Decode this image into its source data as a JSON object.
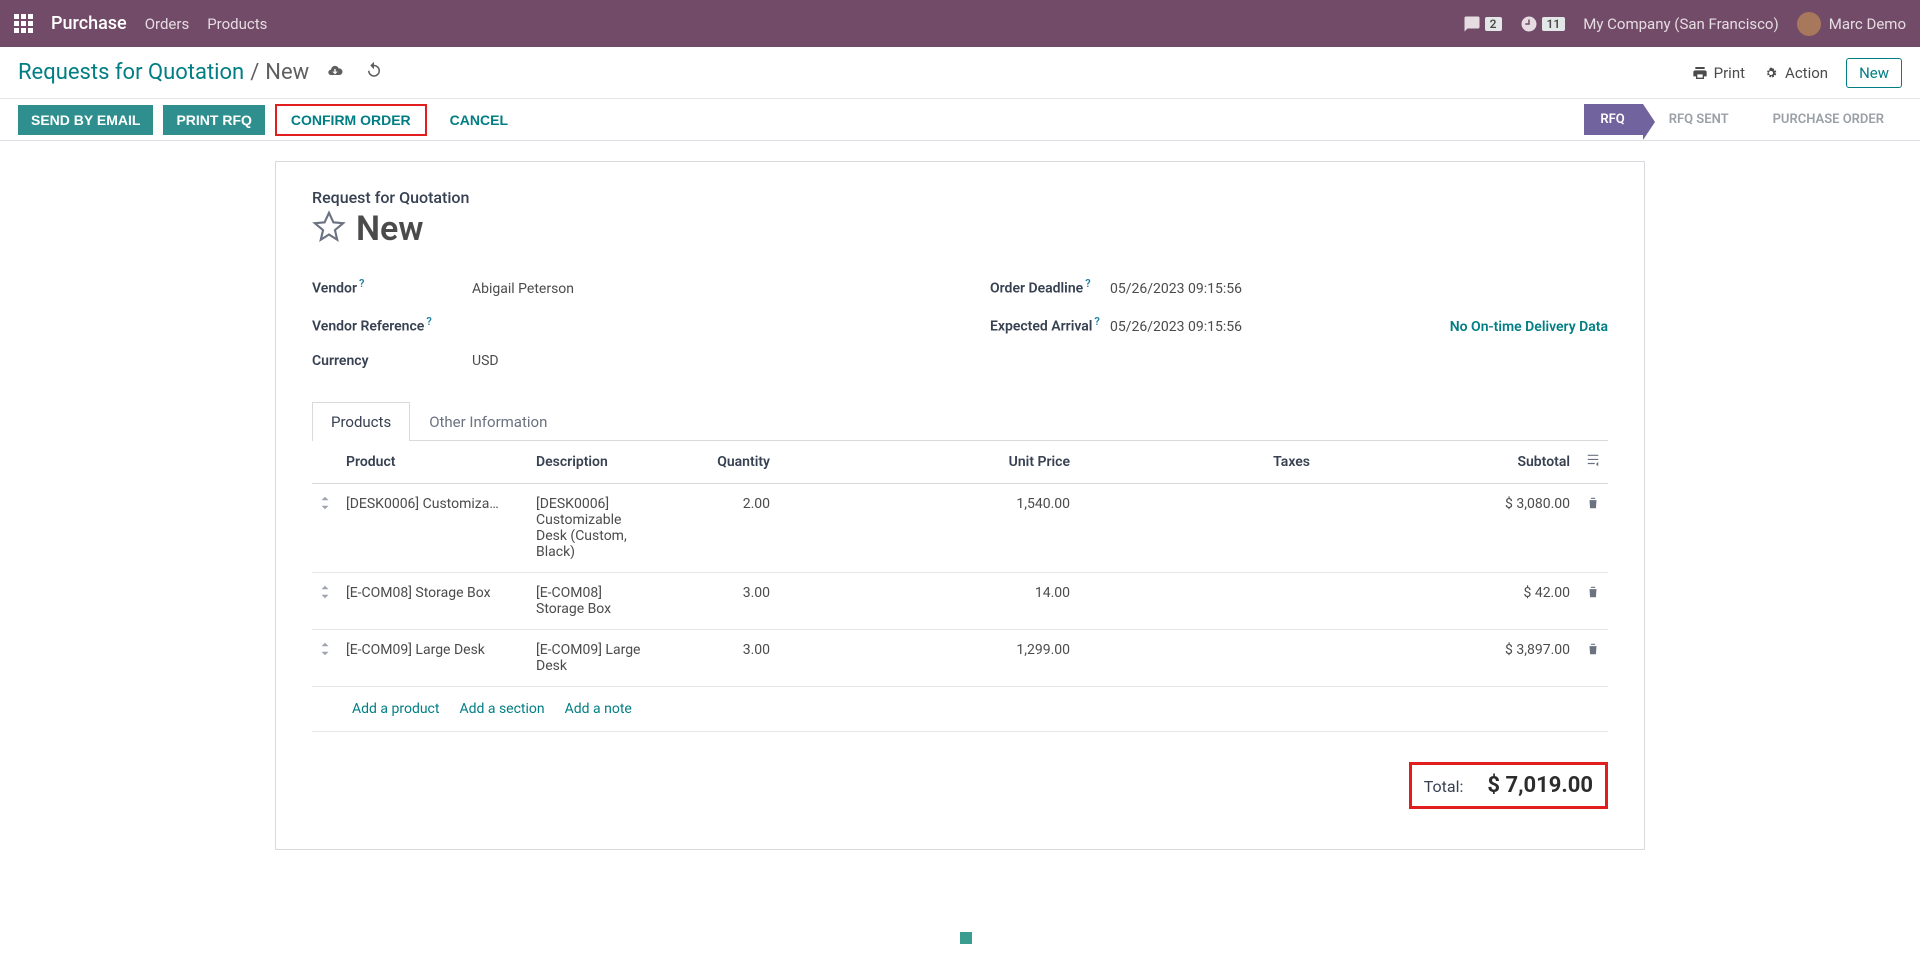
{
  "topnav": {
    "brand": "Purchase",
    "menu": [
      "Orders",
      "Products"
    ],
    "chat_count": "2",
    "clock_count": "11",
    "company": "My Company (San Francisco)",
    "user": "Marc Demo"
  },
  "breadcrumb": {
    "root": "Requests for Quotation",
    "sep": "/",
    "current": "New"
  },
  "toolbar": {
    "print": "Print",
    "action": "Action",
    "new": "New"
  },
  "actions": {
    "send_email": "SEND BY EMAIL",
    "print_rfq": "PRINT RFQ",
    "confirm": "CONFIRM ORDER",
    "cancel": "CANCEL"
  },
  "status": {
    "rfq": "RFQ",
    "rfq_sent": "RFQ SENT",
    "po": "PURCHASE ORDER"
  },
  "form": {
    "subtitle": "Request for Quotation",
    "title": "New",
    "labels": {
      "vendor": "Vendor",
      "vendor_ref": "Vendor Reference",
      "currency": "Currency",
      "order_deadline": "Order Deadline",
      "expected_arrival": "Expected Arrival"
    },
    "values": {
      "vendor": "Abigail Peterson",
      "vendor_ref": "",
      "currency": "USD",
      "order_deadline": "05/26/2023 09:15:56",
      "expected_arrival": "05/26/2023 09:15:56"
    },
    "delivery_link": "No On-time Delivery Data"
  },
  "tabs": {
    "products": "Products",
    "other": "Other Information"
  },
  "table": {
    "headers": {
      "product": "Product",
      "description": "Description",
      "quantity": "Quantity",
      "unit_price": "Unit Price",
      "taxes": "Taxes",
      "subtotal": "Subtotal"
    },
    "rows": [
      {
        "product": "[DESK0006] Customiza…",
        "description": "[DESK0006] Customizable Desk (Custom, Black)",
        "qty": "2.00",
        "unit_price": "1,540.00",
        "taxes": "",
        "subtotal": "$ 3,080.00"
      },
      {
        "product": "[E-COM08] Storage Box",
        "description": "[E-COM08] Storage Box",
        "qty": "3.00",
        "unit_price": "14.00",
        "taxes": "",
        "subtotal": "$ 42.00"
      },
      {
        "product": "[E-COM09] Large Desk",
        "description": "[E-COM09] Large Desk",
        "qty": "3.00",
        "unit_price": "1,299.00",
        "taxes": "",
        "subtotal": "$ 3,897.00"
      }
    ],
    "add": {
      "product": "Add a product",
      "section": "Add a section",
      "note": "Add a note"
    }
  },
  "totals": {
    "label": "Total:",
    "amount": "$ 7,019.00"
  }
}
